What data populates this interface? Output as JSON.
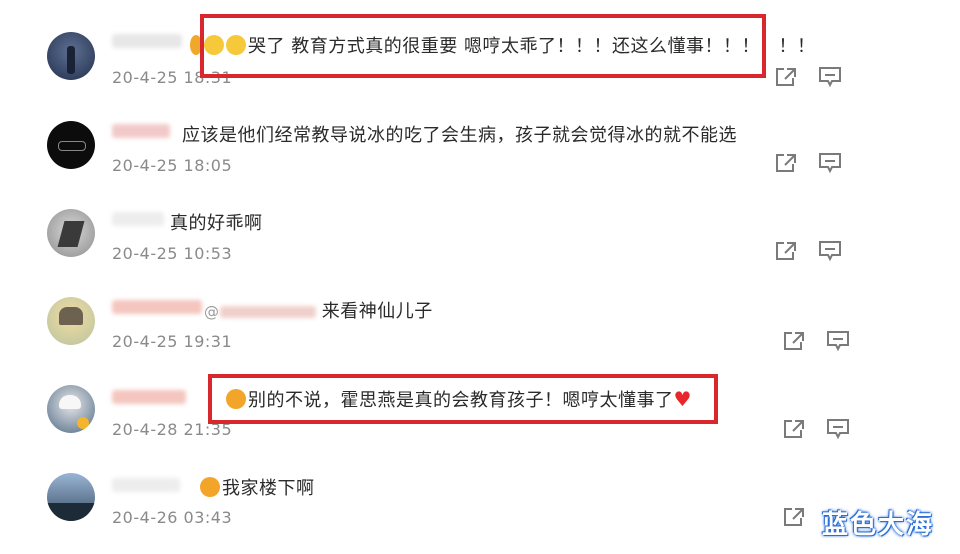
{
  "comments": [
    {
      "text": "哭了  教育方式真的很重要  嗯哼太乖了！！！还这么懂事！！！！！！",
      "time": "20-4-25 18:31",
      "emojis": [
        "crying-face",
        "crying-face"
      ]
    },
    {
      "text": "应该是他们经常教导说冰的吃了会生病，孩子就会觉得冰的就不能选",
      "time": "20-4-25 18:05"
    },
    {
      "text": "真的好乖啊",
      "time": "20-4-25 10:53"
    },
    {
      "mention": "@",
      "text": "来看神仙儿子",
      "time": "20-4-25 19:31"
    },
    {
      "text": "别的不说，霍思燕是真的会教育孩子！嗯哼太懂事了",
      "time": "20-4-28 21:35",
      "emojis": [
        "laughing-crying-face",
        "red-heart"
      ]
    },
    {
      "text": "我家楼下啊",
      "time": "20-4-26 03:43",
      "emojis": [
        "laughing-crying-face"
      ]
    }
  ],
  "icons": {
    "share": "share-icon",
    "reply": "comment-icon"
  },
  "colors": {
    "highlight": "#d9272e",
    "watermark": "#2a6fd6",
    "time": "#8a8a8a"
  },
  "watermark": "蓝色大海"
}
